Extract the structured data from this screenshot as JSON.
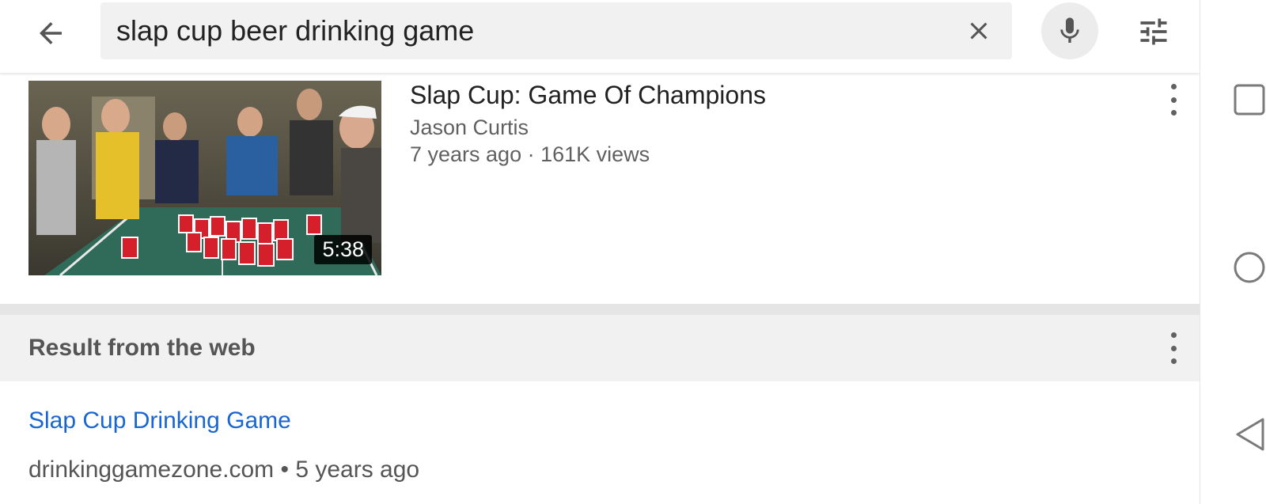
{
  "search": {
    "query": "slap cup beer drinking game"
  },
  "video": {
    "title": "Slap Cup: Game Of Champions",
    "channel": "Jason Curtis",
    "meta": "7 years ago · 161K views",
    "duration": "5:38"
  },
  "web_section": {
    "header": "Result from the web",
    "link_title": "Slap Cup Drinking Game",
    "meta": "drinkinggamezone.com • 5 years ago"
  },
  "icons": {
    "back": "arrow-left-icon",
    "clear": "close-icon",
    "mic": "microphone-icon",
    "filter": "filter-sliders-icon",
    "more": "more-vert-icon",
    "recents": "square-icon",
    "home": "circle-icon",
    "nav_back": "triangle-back-icon"
  },
  "colors": {
    "link": "#1a66d0",
    "search_bg": "#f1f1f1"
  }
}
